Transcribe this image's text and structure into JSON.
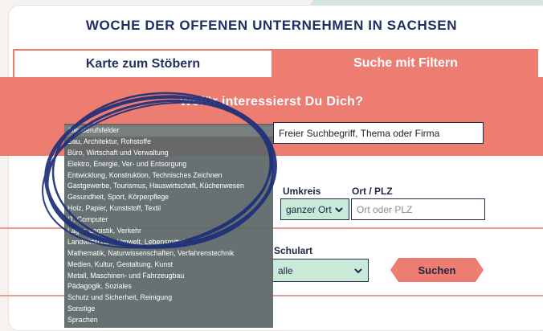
{
  "page_title": "WOCHE DER OFFENEN UNTERNEHMEN IN SACHSEN",
  "tabs": [
    {
      "label": "Karte zum Stöbern",
      "active": false
    },
    {
      "label": "Suche mit Filtern",
      "active": true
    }
  ],
  "question": "Wofür interessierst Du Dich?",
  "search": {
    "placeholder": "Freier Suchbegriff, Thema oder Firma"
  },
  "umkreis": {
    "label": "Umkreis",
    "value": "ganzer Ort"
  },
  "ort": {
    "label": "Ort / PLZ",
    "placeholder": "Ort oder PLZ"
  },
  "schulart": {
    "label": "Schulart",
    "value": "alle"
  },
  "suchen_label": "Suchen",
  "berufsfelder": [
    "Alle Berufsfelder",
    "Bau, Architektur, Rohstoffe",
    "Büro, Wirtschaft und Verwaltung",
    "Elektro, Energie, Ver- und Entsorgung",
    "Entwicklung, Konstruktion, Technisches Zeichnen",
    "Gastgewerbe, Tourismus, Hauswirtschaft, Küchenwesen",
    "Gesundheit, Sport, Körperpflege",
    "Holz, Papier, Kunststoff, Textil",
    "IT, Computer",
    "Lager, Logistik, Verkehr",
    "Landwirtschaft, Umwelt, Lebensmittel",
    "Mathematik, Naturwissenschaften, Verfahrenstechnik",
    "Medien, Kultur, Gestaltung, Kunst",
    "Metall, Maschinen- und Fahrzeugbau",
    "Pädagogik, Soziales",
    "Schutz und Sicherheit, Reinigung",
    "Sonstige",
    "Sprachen"
  ],
  "colors": {
    "accent_salmon": "#ee7d71",
    "navy_text": "#1e2f63",
    "select_mint": "#c9e9d9",
    "background_mint": "#d4e6e1",
    "annotation_circle": "#1d2f78"
  }
}
